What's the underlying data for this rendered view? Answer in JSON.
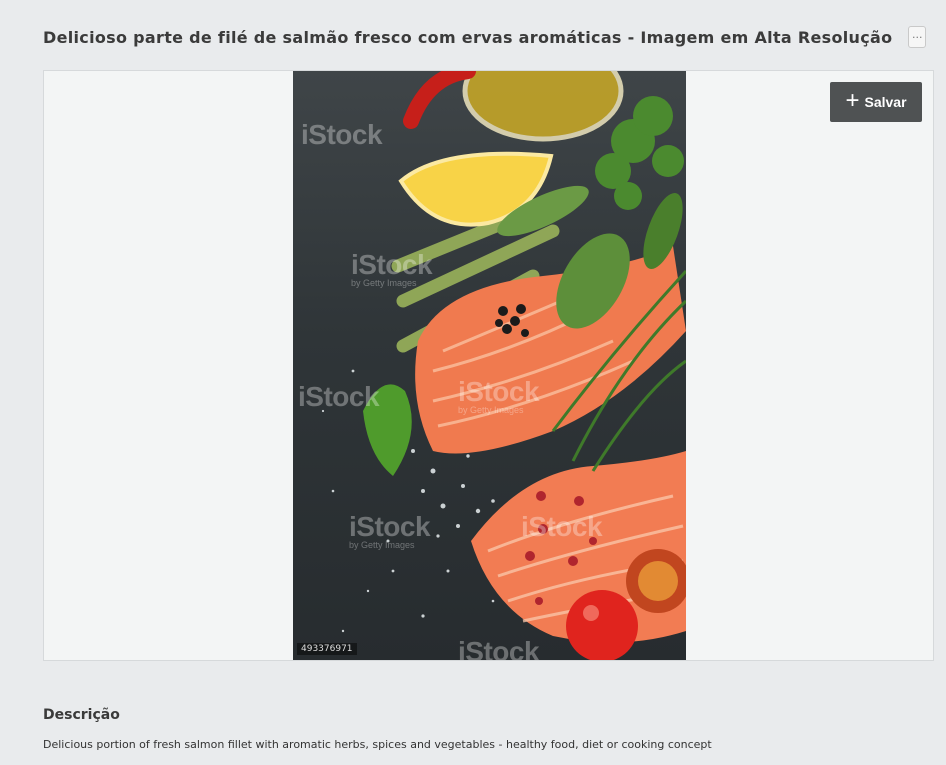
{
  "header": {
    "title": "Delicioso parte de filé de salmão fresco com ervas aromáticas - Imagem em Alta Resolução",
    "more_button_label": "···"
  },
  "image": {
    "save_label": "Salvar",
    "watermark_text": "iStock",
    "watermark_subtext": "by Getty Images",
    "stock_id": "493376971",
    "colors": {
      "slate": "#2f3538",
      "salmon": "#f07a4f",
      "lemon": "#f8d347",
      "tomato": "#e0241e",
      "herb": "#4b8a2f"
    }
  },
  "description": {
    "heading": "Descrição",
    "text": "Delicious portion of fresh salmon fillet with aromatic herbs, spices and vegetables - healthy food, diet or cooking concept"
  }
}
